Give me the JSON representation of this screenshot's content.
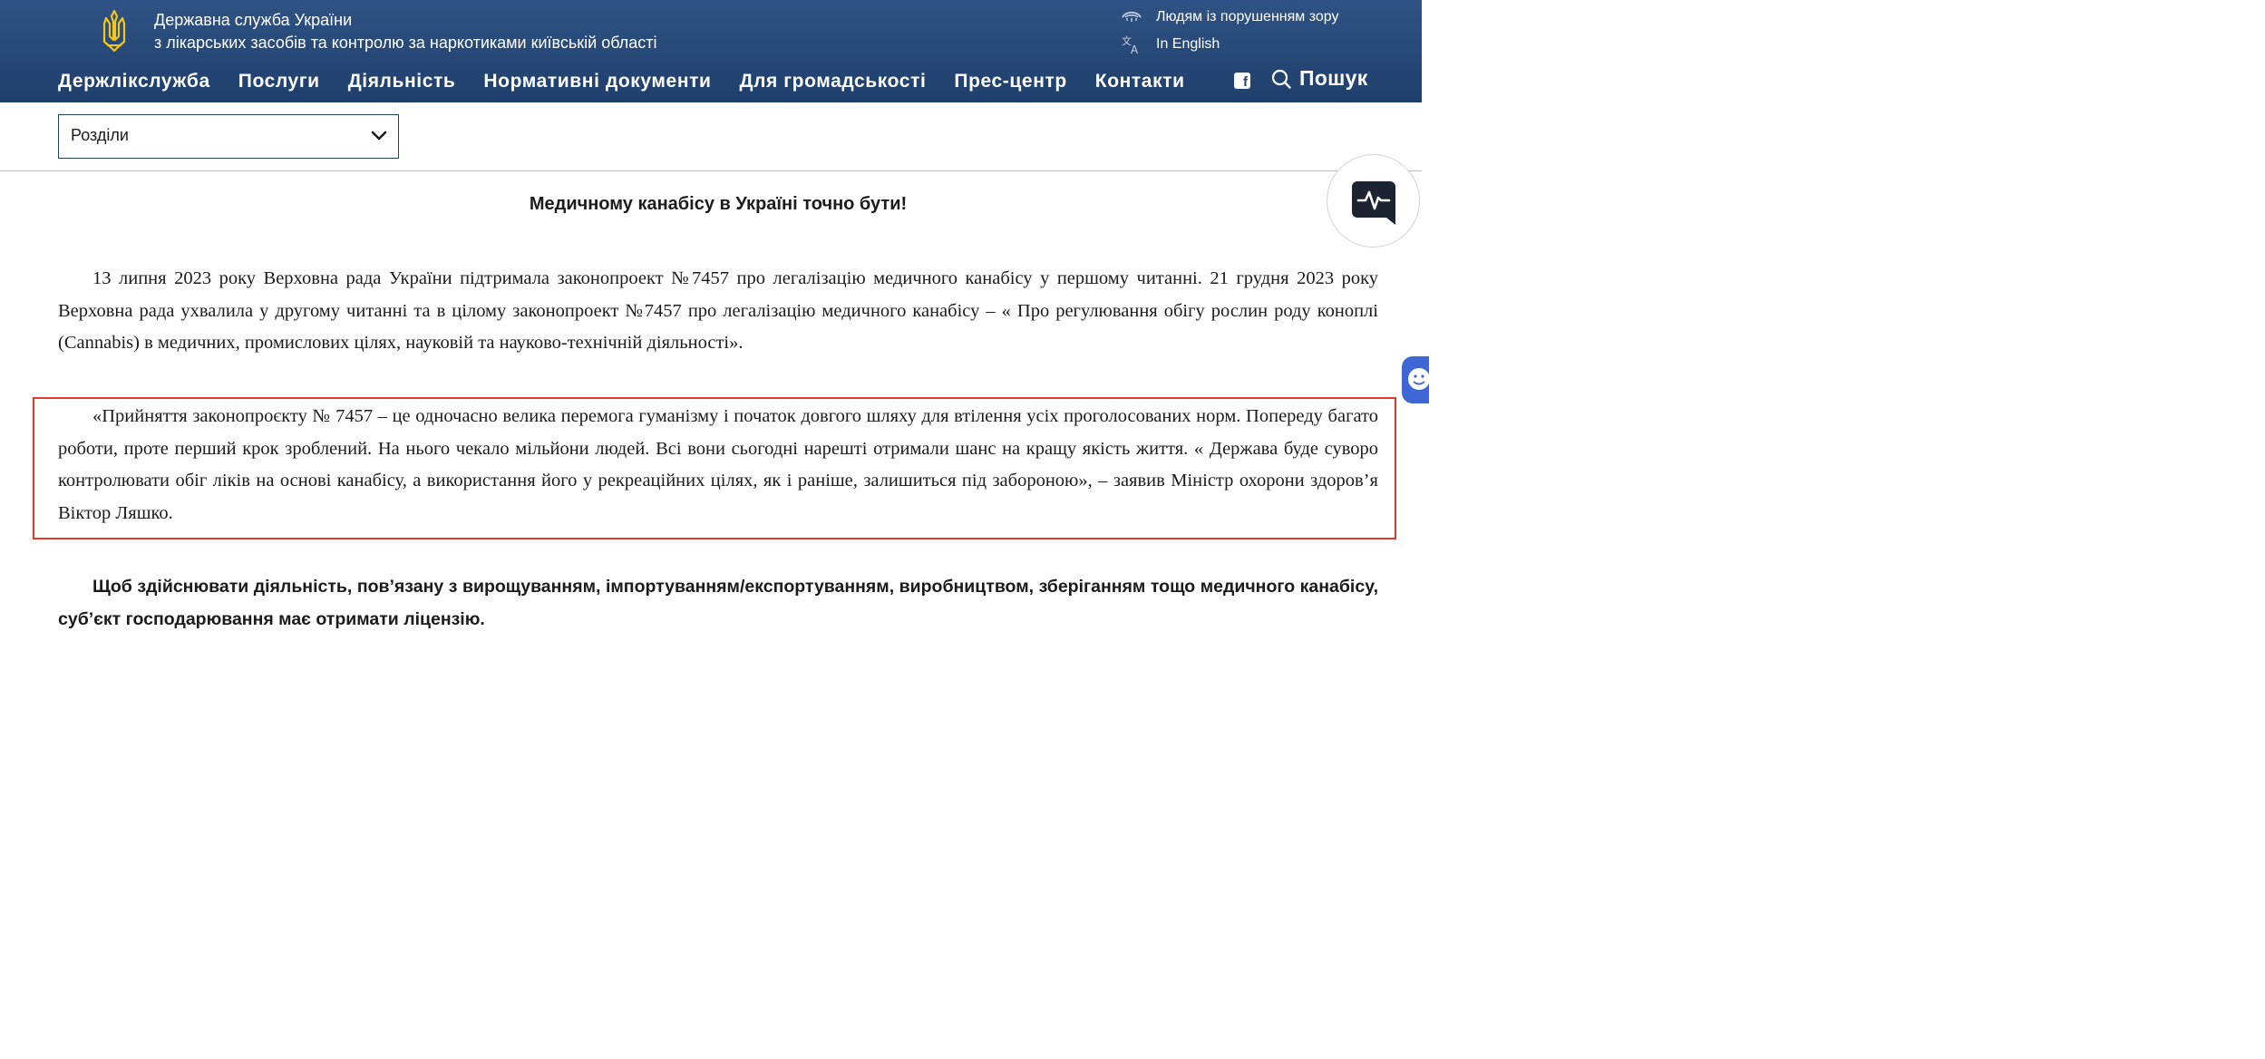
{
  "header": {
    "org_title_line1": "Державна служба України",
    "org_title_line2": "з лікарських засобів та контролю за наркотиками київській області",
    "util_links": {
      "vision_impaired": "Людям із порушенням зору",
      "english": "In English"
    },
    "nav": [
      "Держлікслужба",
      "Послуги",
      "Діяльність",
      "Нормативні документи",
      "Для громадськості",
      "Прес-центр",
      "Контакти"
    ],
    "facebook_glyph": "f",
    "search_label": "Пошук"
  },
  "sections_dropdown": {
    "selected": "Розділи"
  },
  "article": {
    "title": "Медичному канабісу в Україні точно бути!",
    "paragraph_1": "13 липня 2023 року Верховна рада України підтримала законопроект №7457 про легалізацію медичного канабісу у першому читанні. 21 грудня 2023 року Верховна рада ухвалила у другому читанні та в цілому законопроект №7457 про легалізацію медичного канабісу –  « Про регулювання обігу рослин роду коноплі (Cannabis) в медичних, промислових цілях, науковій та науково-технічній діяльності».",
    "paragraph_2": "«Прийняття законопроєкту № 7457 – це одночасно велика перемога гуманізму і початок довгого шляху для втілення усіх проголосованих норм. Попереду багато роботи, проте перший крок зроблений. На нього чекало мільйони людей. Всі вони сьогодні нарешті отримали шанс на кращу якість життя. « Держава буде суворо контролювати обіг ліків на основі канабісу, а використання його у рекреаційних цілях, як і раніше, залишиться під забороною», – заявив Міністр охорони здоров’я Віктор Ляшко.",
    "paragraph_3": "Щоб здійснювати діяльність, пов’язану з вирощуванням, імпортуванням/експортуванням, виробництвом, зберіганням тощо медичного канабісу, суб’єкт господарювання має отримати ліцензію."
  },
  "icons": {
    "logo": "trident-coat-of-arms-icon",
    "vision": "eye-icon",
    "language": "translate-icon",
    "facebook": "facebook-icon",
    "search": "search-icon",
    "dropdown": "chevron-down-icon",
    "chat": "chat-activity-icon",
    "side_tab": "smiley-icon"
  },
  "colors": {
    "header_bg": "#24446f",
    "logo_gold": "#f5c518",
    "highlight_border": "#e03a28",
    "text": "#1b1b1b",
    "side_tab": "#3e66d4",
    "chat_icon": "#1b2430"
  }
}
